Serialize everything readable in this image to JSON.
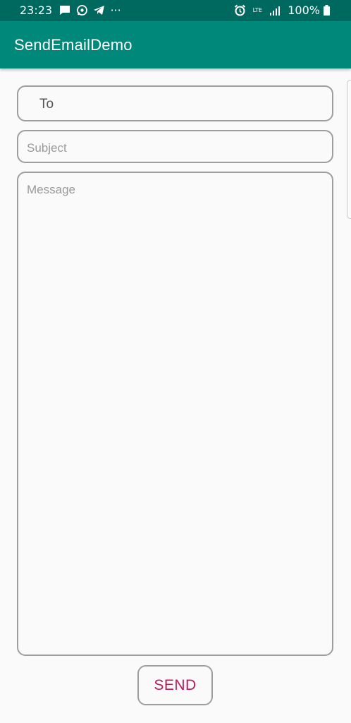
{
  "status_bar": {
    "time": "23:23",
    "more_indicator": "···",
    "network_label": "LTE",
    "battery_percent": "100%",
    "left_icons": [
      "message-icon",
      "whatsapp-icon",
      "telegram-icon"
    ],
    "right_icons": [
      "alarm-icon",
      "volte-icon",
      "signal-icon",
      "battery-icon"
    ],
    "color": "#00695f"
  },
  "app_bar": {
    "title": "SendEmailDemo",
    "color": "#00897b"
  },
  "form": {
    "to_label": "To",
    "subject_placeholder": "Subject",
    "message_placeholder": "Message"
  },
  "send_button": {
    "label": "SEND",
    "color": "#c2185b"
  }
}
